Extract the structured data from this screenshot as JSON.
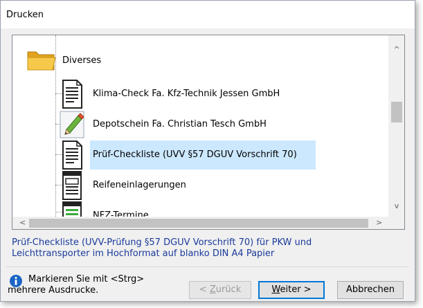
{
  "window": {
    "title": "Drucken"
  },
  "tree": {
    "folder": {
      "label": "Diverses",
      "icon": "folder-icon"
    },
    "items": [
      {
        "label": "Klima-Check Fa. Kfz-Technik Jessen GmbH",
        "icon": "document-icon",
        "selected": false
      },
      {
        "label": "Depotschein Fa. Christian Tesch GmbH",
        "icon": "pencil-icon",
        "selected": false
      },
      {
        "label": "Prüf-Checkliste (UVV §57 DGUV Vorschrift 70)",
        "icon": "document-icon",
        "selected": true
      },
      {
        "label": "Reifeneinlagerungen",
        "icon": "form-icon",
        "selected": false
      },
      {
        "label": "NFZ-Termine",
        "icon": "form-green-icon",
        "selected": false
      }
    ]
  },
  "scrollbars": {
    "up": "^",
    "down": "v",
    "left": "<",
    "right": ">"
  },
  "description": {
    "line1": "Prüf-Checkliste (UVV-Prüfung §57 DGUV Vorschrift 70) für PKW und",
    "line2": "Leichttransporter im Hochformat auf blanko DIN A4 Papier"
  },
  "hint": {
    "line1": "Markieren Sie mit <Strg>",
    "line2": "mehrere Ausdrucke.",
    "icon": "info-icon"
  },
  "buttons": {
    "back": {
      "prefix": "< ",
      "underlined": "Z",
      "rest": "urück",
      "enabled": false
    },
    "next": {
      "underlined": "W",
      "rest": "eiter >",
      "enabled": true
    },
    "cancel": {
      "label": "Abbrechen",
      "enabled": true
    }
  },
  "colors": {
    "selection": "#cce8ff",
    "description_text": "#1a3a9a",
    "default_button_border": "#0078d7",
    "info_icon": "#1c65c5"
  }
}
